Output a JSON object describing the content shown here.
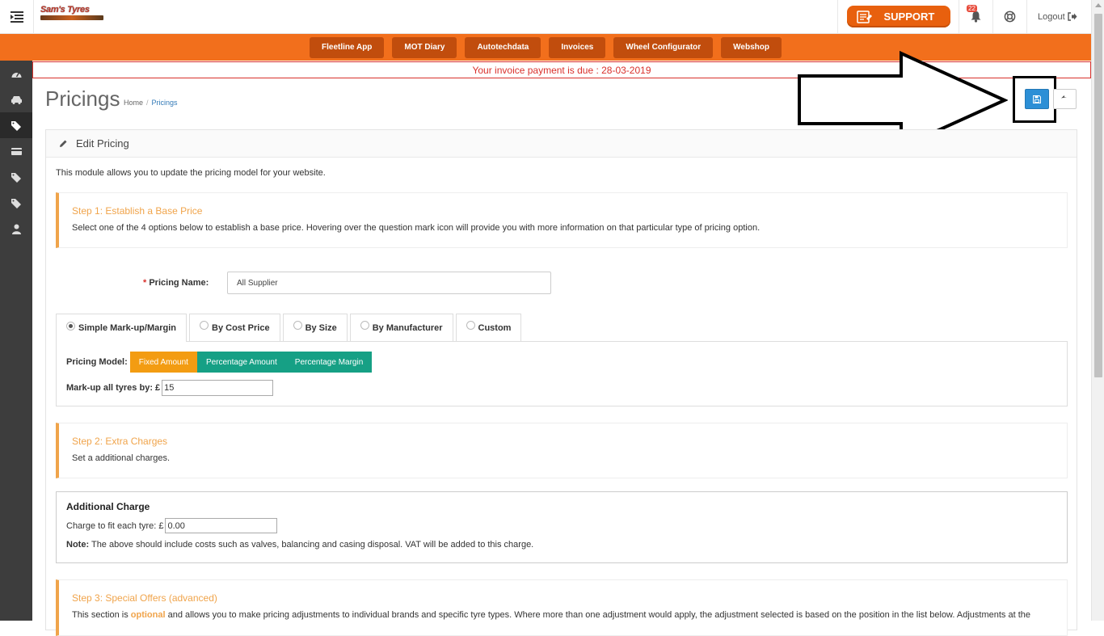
{
  "brand": {
    "logo_text": "Sam's Tyres"
  },
  "topbar": {
    "support_label": "SUPPORT",
    "notification_count": "22",
    "logout_label": "Logout"
  },
  "nav": {
    "items": [
      {
        "label": "Fleetline App"
      },
      {
        "label": "MOT Diary"
      },
      {
        "label": "Autotechdata"
      },
      {
        "label": "Invoices"
      },
      {
        "label": "Wheel Configurator"
      },
      {
        "label": "Webshop"
      }
    ]
  },
  "alert": {
    "text": "Your invoice payment is due : 28-03-2019"
  },
  "page": {
    "title": "Pricings",
    "breadcrumb": [
      "Home",
      "Pricings"
    ]
  },
  "panel": {
    "heading": "Edit Pricing",
    "intro": "This module allows you to update the pricing model for your website."
  },
  "step1": {
    "title": "Step 1: Establish a Base Price",
    "desc": "Select one of the 4 options below to establish a base price. Hovering over the question mark icon will provide you with more information on that particular type of pricing option."
  },
  "pricing_name": {
    "label": "Pricing Name:",
    "required_mark": "*",
    "value": "All Supplier"
  },
  "tabs": [
    {
      "label": "Simple Mark-up/Margin",
      "selected": true
    },
    {
      "label": "By Cost Price",
      "selected": false
    },
    {
      "label": "By Size",
      "selected": false
    },
    {
      "label": "By Manufacturer",
      "selected": false
    },
    {
      "label": "Custom",
      "selected": false
    }
  ],
  "pricing_model": {
    "label": "Pricing Model:",
    "options": [
      "Fixed Amount",
      "Percentage Amount",
      "Percentage Margin"
    ],
    "selected": "Fixed Amount"
  },
  "markup": {
    "label": "Mark-up all tyres by: £",
    "value": "15"
  },
  "step2": {
    "title": "Step 2: Extra Charges",
    "desc": "Set a additional charges."
  },
  "additional_charge": {
    "title": "Additional Charge",
    "fit_label": "Charge to fit each tyre: £",
    "fit_value": "0.00",
    "note_label": "Note:",
    "note_text": "The above should include costs such as valves, balancing and casing disposal. VAT will be added to this charge."
  },
  "step3": {
    "title": "Step 3: Special Offers (advanced)",
    "desc_pre": "This section is",
    "desc_optional": "optional",
    "desc_post": "and allows you to make pricing adjustments to individual brands and specific tyre types. Where more than one adjustment would apply, the adjustment selected is based on the position in the list below. Adjustments at the"
  },
  "colors": {
    "orange_nav": "#f26f1c",
    "nav_button": "#c14d0d",
    "alert_red": "#d9312c",
    "step_accent": "#f0a44b",
    "save_blue": "#2c8fd6",
    "seg_orange": "#f39c12",
    "seg_green": "#16a085"
  },
  "icons": {
    "sidebar": [
      "dashboard-icon",
      "car-icon",
      "tags-icon",
      "credit-card-icon",
      "tags-icon",
      "tags-icon",
      "user-icon"
    ]
  }
}
